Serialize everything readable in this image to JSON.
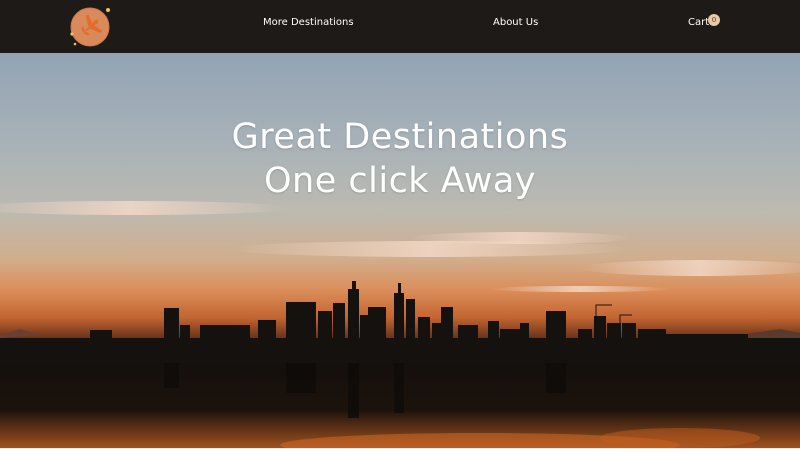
{
  "nav": {
    "logo": "airplane-logo",
    "links": [
      "More Destinations",
      "About Us"
    ],
    "cart_label": "Cart",
    "cart_count": "0"
  },
  "hero": {
    "title_line1": "Great Destinations",
    "title_line2": "One click Away",
    "image": "city-skyline-sunset"
  },
  "colors": {
    "navbar": "#1e1a17",
    "logo_circle": "#d9895a",
    "plane": "#e46b2a",
    "badge": "#e7c9a6"
  }
}
